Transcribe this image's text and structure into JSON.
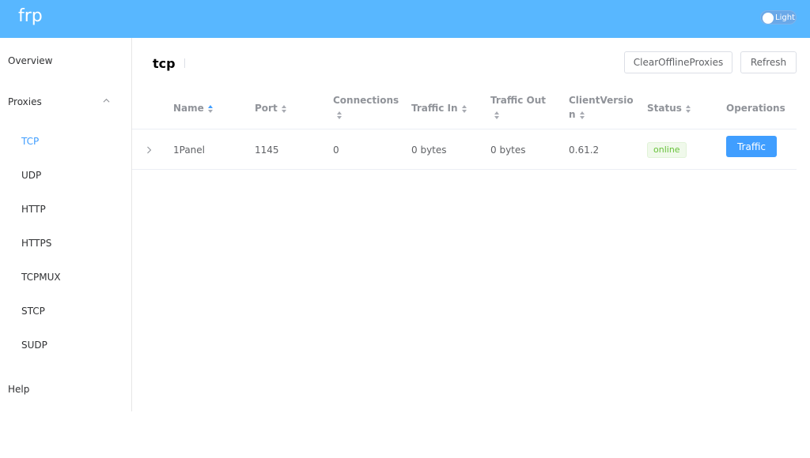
{
  "header": {
    "brand": "frp",
    "theme_label": "Light"
  },
  "sidebar": {
    "overview": "Overview",
    "proxies": "Proxies",
    "items": [
      {
        "label": "TCP",
        "active": true
      },
      {
        "label": "UDP",
        "active": false
      },
      {
        "label": "HTTP",
        "active": false
      },
      {
        "label": "HTTPS",
        "active": false
      },
      {
        "label": "TCPMUX",
        "active": false
      },
      {
        "label": "STCP",
        "active": false
      },
      {
        "label": "SUDP",
        "active": false
      }
    ],
    "help": "Help"
  },
  "main": {
    "title": "tcp",
    "clear_button": "ClearOfflineProxies",
    "refresh_button": "Refresh"
  },
  "table": {
    "columns": {
      "name": "Name",
      "port": "Port",
      "connections": "Connections",
      "traffic_in": "Traffic In",
      "traffic_out": "Traffic Out",
      "client_version_1": "ClientVersio",
      "client_version_2": "n",
      "status": "Status",
      "operations": "Operations"
    },
    "rows": [
      {
        "name": "1Panel",
        "port": "1145",
        "connections": "0",
        "traffic_in": "0 bytes",
        "traffic_out": "0 bytes",
        "client_version": "0.61.2",
        "status": "online",
        "operation": "Traffic"
      }
    ]
  },
  "colors": {
    "header_bg": "#58b7ff",
    "accent": "#409eff",
    "online": "#67c23a"
  }
}
